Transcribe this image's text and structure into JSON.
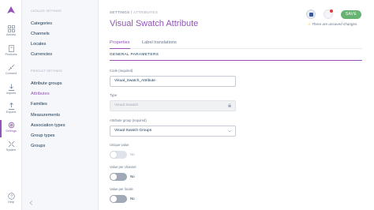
{
  "iconbar": {
    "items": [
      {
        "label": "Activity",
        "icon": "activity-icon"
      },
      {
        "label": "Products",
        "icon": "products-icon"
      },
      {
        "label": "Connect",
        "icon": "connect-icon"
      },
      {
        "label": "Imports",
        "icon": "imports-icon"
      },
      {
        "label": "Exports",
        "icon": "exports-icon"
      },
      {
        "label": "Settings",
        "icon": "settings-icon"
      },
      {
        "label": "System",
        "icon": "system-icon"
      }
    ],
    "help": "Help"
  },
  "panel": {
    "catalog_title": "CATALOG SETTINGS",
    "catalog_links": [
      "Categories",
      "Channels",
      "Locales",
      "Currencies"
    ],
    "product_title": "PRODUCT SETTINGS",
    "product_links": [
      "Attribute groups",
      "Attributes",
      "Families",
      "Measurements",
      "Association types",
      "Group types",
      "Groups"
    ],
    "active_link": "Attributes"
  },
  "header": {
    "breadcrumb_root": "SETTINGS",
    "breadcrumb_sep": "/",
    "breadcrumb_current": "ATTRIBUTES",
    "title": "Visual Swatch Attribute",
    "save_label": "SAVE",
    "unsaved_text": "There are unsaved changes."
  },
  "tabs": [
    "Properties",
    "Label translations"
  ],
  "section_title": "GENERAL PARAMETERS",
  "form": {
    "code_label": "Code (required)",
    "code_value": "Visual_Swatch_Attribute",
    "type_label": "Type",
    "type_value": "Visual Swatch",
    "group_label": "Attribute group (required)",
    "group_value": "Visual Swatch Groups",
    "unique_label": "Unique value",
    "unique_value": "No",
    "per_channel_label": "Value per channel",
    "per_channel_value": "No",
    "per_locale_label": "Value per locale",
    "per_locale_value": "No"
  },
  "colors": {
    "accent": "#9452ba",
    "save": "#67b373"
  }
}
